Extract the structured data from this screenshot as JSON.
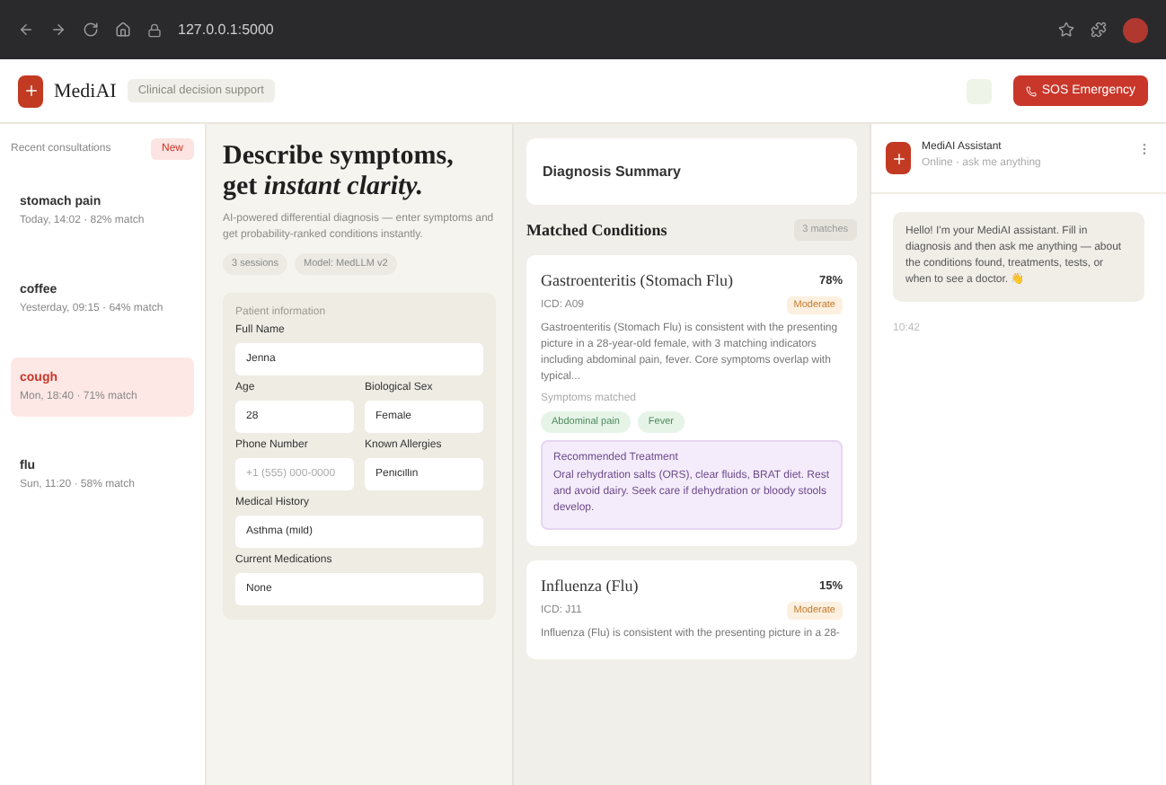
{
  "browser": {
    "url": "127.0.0.1:5000"
  },
  "header": {
    "logo": "MediAI",
    "badge": "Clinical decision support",
    "emergency_button": "SOS Emergency"
  },
  "sidebar": {
    "title": "Recent consultations",
    "new_button": "New",
    "items": [
      {
        "title": "stomach pain",
        "meta": "Today, 14:02 · 82% match",
        "selected": false
      },
      {
        "title": "coffee",
        "meta": "Yesterday, 09:15 · 64% match",
        "selected": false
      },
      {
        "title": "cough",
        "meta": "Mon, 18:40 · 71% match",
        "selected": true
      },
      {
        "title": "flu",
        "meta": "Sun, 11:20 · 58% match",
        "selected": false
      }
    ]
  },
  "intro": {
    "title": "Describe symptoms,",
    "title_accent": "get *instant clarity.*",
    "subtitle": "AI-powered differential diagnosis — enter symptoms and get probability-ranked conditions instantly.",
    "chips": [
      "3 sessions",
      "Model: MedLLM v2"
    ]
  },
  "form": {
    "title": "Patient information",
    "rows": [
      [
        {
          "label": "Full Name",
          "value": "Jenna"
        }
      ],
      [
        {
          "label": "Age",
          "value": "28"
        },
        {
          "label": "Biological Sex",
          "value": "Female"
        }
      ],
      [
        {
          "label": "Phone Number",
          "placeholder": "+1 (555) 000-0000"
        },
        {
          "label": "Known Allergies",
          "value": "Penicillin"
        }
      ],
      [
        {
          "label": "Medical History",
          "value": "Asthma (mild)"
        }
      ],
      [
        {
          "label": "Current Medications",
          "value": "None"
        }
      ]
    ]
  },
  "results": {
    "summary_title": "Diagnosis Summary",
    "conditions_title": "Matched Conditions",
    "count": "3 matches",
    "conditions": [
      {
        "name": "Gastroenteritis (Stomach Flu)",
        "code": "ICD: A09",
        "probability": "78%",
        "severity": "Moderate",
        "description": "Gastroenteritis (Stomach Flu) is consistent with the presenting picture in a 28-year-old female, with 3 matching indicators including abdominal pain, fever. Core symptoms overlap with typical...",
        "matched_label": "Symptoms matched",
        "tags": [
          "Abdominal pain",
          "Fever"
        ],
        "treatment_title": "Recommended Treatment",
        "treatment": "Oral rehydration salts (ORS), clear fluids, BRAT diet. Rest and avoid dairy. Seek care if dehydration or bloody stools develop."
      },
      {
        "name": "Influenza (Flu)",
        "code": "ICD: J11",
        "probability": "15%",
        "severity": "Moderate",
        "description": "Influenza (Flu) is consistent with the presenting picture in a 28-"
      }
    ]
  },
  "chat": {
    "title": "MediAI Assistant",
    "status": "Online · ask me anything",
    "messages": [
      {
        "text": "Hello! I'm your MediAI assistant. Fill in diagnosis and then ask me anything — about the conditions found, treatments, tests, or when to see a doctor. 👋",
        "time": "10:42"
      }
    ]
  }
}
